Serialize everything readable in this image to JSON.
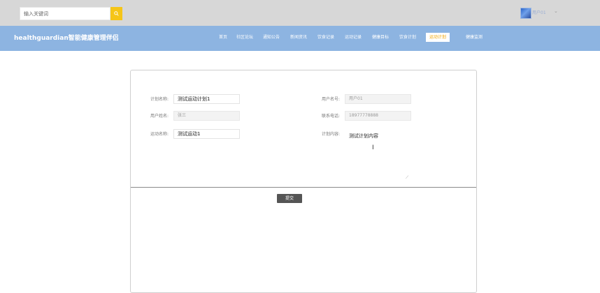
{
  "search": {
    "placeholder": "输入关键词",
    "icon": "search-icon"
  },
  "user": {
    "name": "用户01",
    "caret": "⌄"
  },
  "brand": "healthguardian智能健康管理伴侣",
  "nav": {
    "items": [
      {
        "label": "首页"
      },
      {
        "label": "社区论坛"
      },
      {
        "label": "通知公告"
      },
      {
        "label": "新闻资讯"
      },
      {
        "label": "饮食记录"
      },
      {
        "label": "运动记录"
      },
      {
        "label": "健康目标"
      },
      {
        "label": "饮食计划"
      },
      {
        "label": "运动计划"
      },
      {
        "label": "健康监测"
      }
    ],
    "active_index": 8,
    "active_color": "#f0a500"
  },
  "form": {
    "plan_name": {
      "label": "计划名称:",
      "value": "测试运动计划1"
    },
    "user_account": {
      "label": "用户名号:",
      "value": "用户01"
    },
    "user_name": {
      "label": "用户姓名:",
      "value": "张三"
    },
    "phone": {
      "label": "联系电话:",
      "value": "18977778888"
    },
    "exercise_name": {
      "label": "运动名称:",
      "value": "测试运动1"
    },
    "plan_content": {
      "label": "计划内容:",
      "value": "测试计划内容"
    },
    "submit_label": "提交"
  },
  "colors": {
    "topbar": "#d7d7d7",
    "navbar": "#8db4e1",
    "search_button": "#f5c518"
  }
}
